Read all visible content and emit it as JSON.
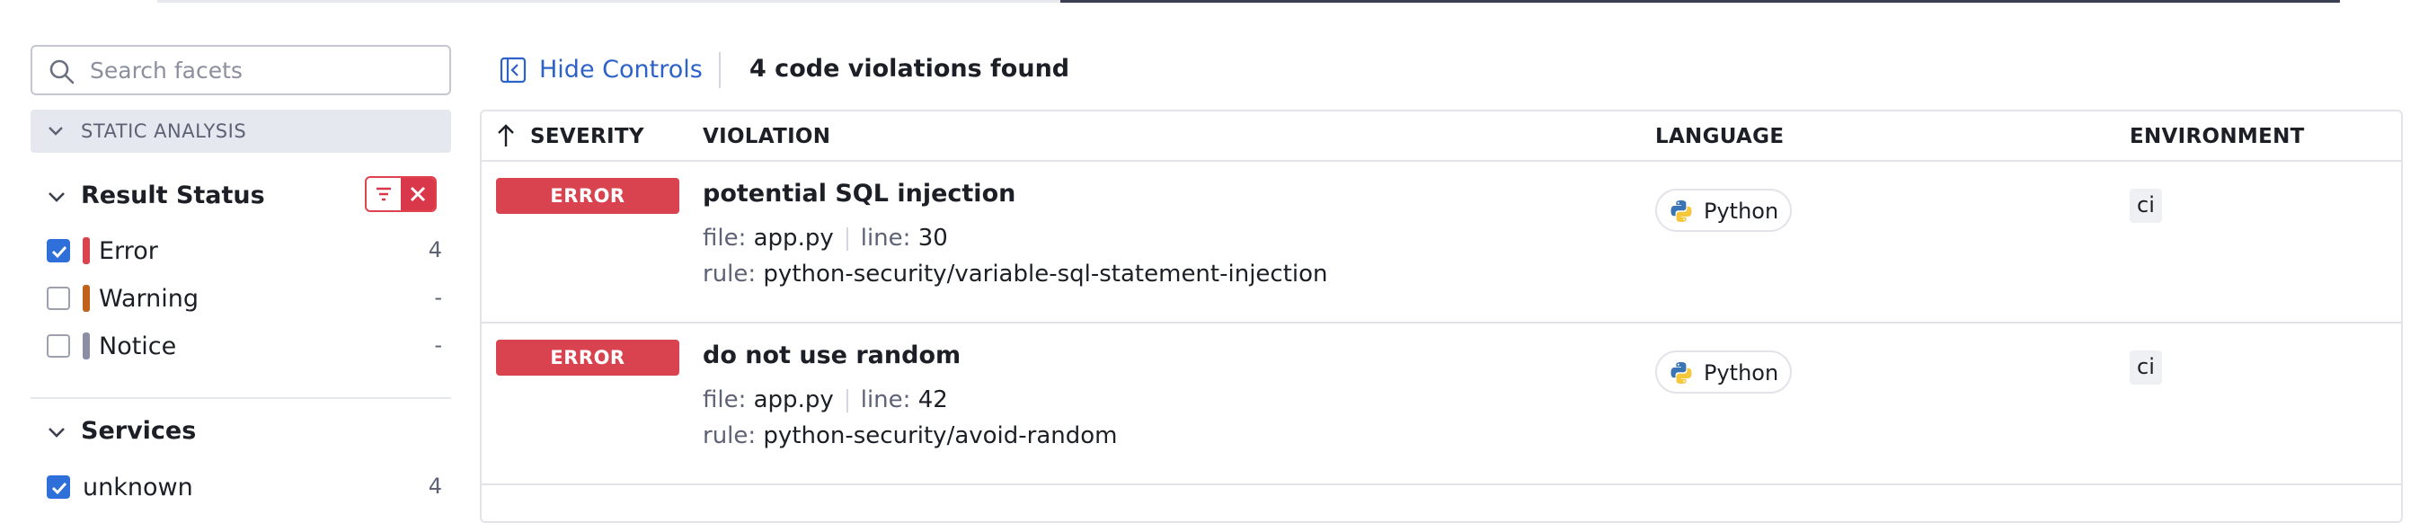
{
  "sidebar": {
    "search_placeholder": "Search facets",
    "section_label": "STATIC ANALYSIS",
    "result_status": {
      "title": "Result Status",
      "items": [
        {
          "label": "Error",
          "count": "4",
          "checked": true,
          "color": "#d9434f"
        },
        {
          "label": "Warning",
          "count": "-",
          "checked": false,
          "color": "#c0621c"
        },
        {
          "label": "Notice",
          "count": "-",
          "checked": false,
          "color": "#8b8fa3"
        }
      ]
    },
    "services": {
      "title": "Services",
      "items": [
        {
          "label": "unknown",
          "count": "4",
          "checked": true
        }
      ]
    }
  },
  "toolbar": {
    "hide_controls_label": "Hide Controls",
    "result_count": "4 code violations found"
  },
  "table": {
    "columns": [
      "SEVERITY",
      "VIOLATION",
      "LANGUAGE",
      "ENVIRONMENT"
    ],
    "rows": [
      {
        "severity": "ERROR",
        "title": "potential SQL injection",
        "file_key": "file:",
        "file": "app.py",
        "line_key": "line:",
        "line": "30",
        "rule_key": "rule:",
        "rule": "python-security/variable-sql-statement-injection",
        "language": "Python",
        "environment": "ci"
      },
      {
        "severity": "ERROR",
        "title": "do not use random",
        "file_key": "file:",
        "file": "app.py",
        "line_key": "line:",
        "line": "42",
        "rule_key": "rule:",
        "rule": "python-security/avoid-random",
        "language": "Python",
        "environment": "ci"
      }
    ]
  },
  "colors": {
    "error": "#d9434f",
    "accent": "#2e6fd9",
    "link": "#2d62c9"
  },
  "icons": [
    "search-icon",
    "chevron-down-icon",
    "filter-icon",
    "close-icon",
    "sidebar-collapse-icon",
    "sort-up-icon",
    "python-icon"
  ]
}
